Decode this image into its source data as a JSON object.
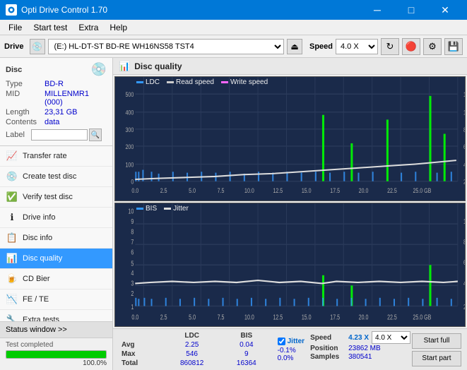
{
  "titleBar": {
    "title": "Opti Drive Control 1.70",
    "minimizeLabel": "─",
    "maximizeLabel": "□",
    "closeLabel": "✕"
  },
  "menuBar": {
    "items": [
      "File",
      "Start test",
      "Extra",
      "Help"
    ]
  },
  "driveBar": {
    "driveLabel": "Drive",
    "driveValue": "(E:) HL-DT-ST BD-RE  WH16NS58 TST4",
    "speedLabel": "Speed",
    "speedValue": "4.0 X"
  },
  "discPanel": {
    "label": "Disc",
    "typeKey": "Type",
    "typeVal": "BD-R",
    "midKey": "MID",
    "midVal": "MILLENMR1 (000)",
    "lengthKey": "Length",
    "lengthVal": "23,31 GB",
    "contentsKey": "Contents",
    "contentsVal": "data",
    "labelKey": "Label"
  },
  "navItems": [
    {
      "id": "transfer-rate",
      "label": "Transfer rate",
      "icon": "📈"
    },
    {
      "id": "create-test-disc",
      "label": "Create test disc",
      "icon": "💿"
    },
    {
      "id": "verify-test-disc",
      "label": "Verify test disc",
      "icon": "✅"
    },
    {
      "id": "drive-info",
      "label": "Drive info",
      "icon": "ℹ"
    },
    {
      "id": "disc-info",
      "label": "Disc info",
      "icon": "📋"
    },
    {
      "id": "disc-quality",
      "label": "Disc quality",
      "icon": "📊",
      "active": true
    },
    {
      "id": "cd-bier",
      "label": "CD Bier",
      "icon": "🍺"
    },
    {
      "id": "fe-te",
      "label": "FE / TE",
      "icon": "📉"
    },
    {
      "id": "extra-tests",
      "label": "Extra tests",
      "icon": "🔧"
    }
  ],
  "statusBtn": "Status window >>",
  "progressText": "Test completed",
  "progressValue": "100.0%",
  "discQuality": {
    "title": "Disc quality",
    "legendLDC": "LDC",
    "legendRead": "Read speed",
    "legendWrite": "Write speed",
    "legendBIS": "BIS",
    "legendJitter": "Jitter"
  },
  "statsTable": {
    "headers": [
      "",
      "LDC",
      "BIS"
    ],
    "rows": [
      {
        "label": "Avg",
        "ldc": "2.25",
        "bis": "0.04"
      },
      {
        "label": "Max",
        "ldc": "546",
        "bis": "9"
      },
      {
        "label": "Total",
        "ldc": "860812",
        "bis": "16364"
      }
    ]
  },
  "jitter": {
    "label": "Jitter",
    "avg": "-0.1%",
    "max": "0.0%"
  },
  "speedInfo": {
    "speedLabel": "Speed",
    "speedVal": "4.23 X",
    "positionLabel": "Position",
    "positionVal": "23862 MB",
    "samplesLabel": "Samples",
    "samplesVal": "380541",
    "speedSelectVal": "4.0 X"
  },
  "buttons": {
    "startFull": "Start full",
    "startPart": "Start part"
  }
}
